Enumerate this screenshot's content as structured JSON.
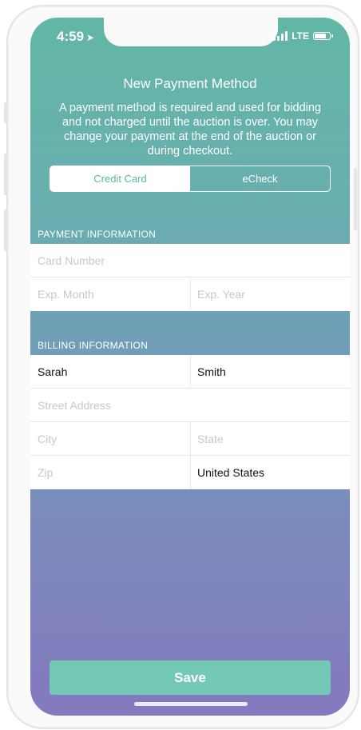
{
  "status": {
    "time": "4:59",
    "location_icon": "location-arrow-icon",
    "network": "LTE",
    "battery_level": 0.8
  },
  "header": {
    "title": "New Payment Method",
    "subtitle": "A payment method is required and used for bidding and not charged until the auction is over. You may change your payment at the end of the auction or during checkout."
  },
  "tabs": [
    {
      "label": "Credit Card",
      "active": true
    },
    {
      "label": "eCheck",
      "active": false
    }
  ],
  "payment": {
    "section_label": "PAYMENT INFORMATION",
    "card_number_placeholder": "Card Number",
    "exp_month_placeholder": "Exp. Month",
    "exp_year_placeholder": "Exp. Year"
  },
  "billing": {
    "section_label": "BILLING INFORMATION",
    "first_name": "Sarah",
    "last_name": "Smith",
    "street_placeholder": "Street Address",
    "city_placeholder": "City",
    "state_placeholder": "State",
    "zip_placeholder": "Zip",
    "country": "United States"
  },
  "actions": {
    "save_label": "Save"
  },
  "colors": {
    "accent": "#74c9b6",
    "gradient_top": "#62b7a5",
    "gradient_bottom": "#8479be"
  }
}
